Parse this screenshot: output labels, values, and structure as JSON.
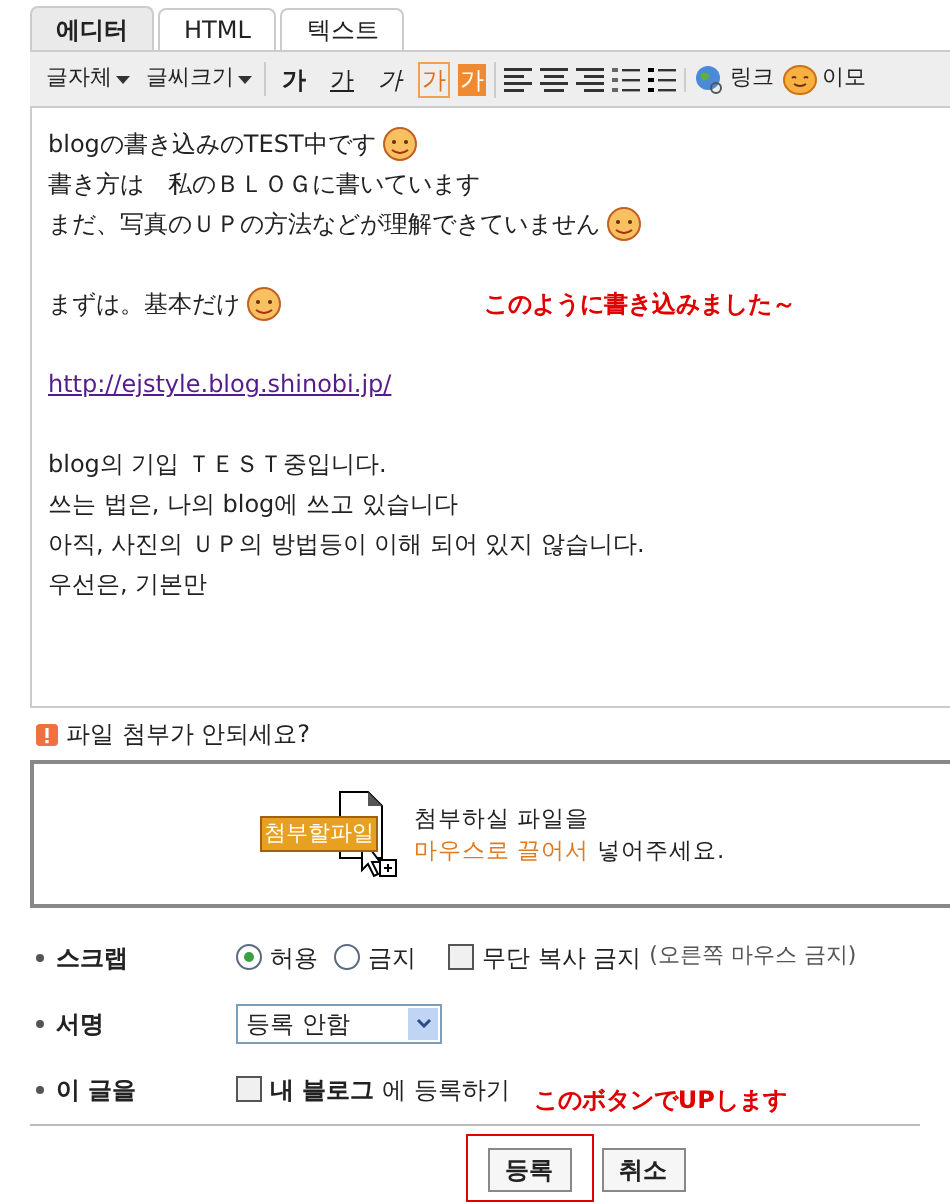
{
  "tabs": [
    {
      "label": "에디터",
      "selected": true
    },
    {
      "label": "HTML",
      "selected": false
    },
    {
      "label": "텍스트",
      "selected": false
    }
  ],
  "toolbar": {
    "groups": [
      [
        {
          "kind": "dropdown",
          "label": "글자체"
        },
        {
          "kind": "dropdown",
          "label": "글씨크기"
        }
      ],
      [
        {
          "kind": "bold",
          "label": "가"
        },
        {
          "kind": "underline",
          "label": "가"
        },
        {
          "kind": "italic",
          "label": "가"
        },
        {
          "kind": "color",
          "label": "가"
        },
        {
          "kind": "highlight",
          "label": "가"
        }
      ],
      [
        {
          "kind": "align-left"
        },
        {
          "kind": "align-center"
        },
        {
          "kind": "align-right"
        },
        {
          "kind": "numbered-list"
        },
        {
          "kind": "bullet-list"
        }
      ],
      [
        {
          "kind": "link",
          "label": "링크"
        },
        {
          "kind": "emoticon",
          "label": "이모"
        }
      ]
    ]
  },
  "content": {
    "lines": [
      {
        "kind": "text",
        "text": "blogの書き込みのTEST中です",
        "emoticon": true
      },
      {
        "kind": "text",
        "text": "書き方は　私のＢＬＯＧに書いています",
        "emoticon": false
      },
      {
        "kind": "text",
        "text": "まだ、写真のＵＰの方法などが理解できていません",
        "emoticon": true
      },
      {
        "kind": "blank"
      },
      {
        "kind": "text",
        "text": "まずは。基本だけ",
        "emoticon": true,
        "note": "このように書き込みました～"
      },
      {
        "kind": "blank"
      },
      {
        "kind": "link",
        "text": "http://ejstyle.blog.shinobi.jp/"
      },
      {
        "kind": "blank"
      },
      {
        "kind": "text",
        "text": "blog의 기입 ＴＥＳＴ중입니다.",
        "emoticon": false
      },
      {
        "kind": "text",
        "text": "쓰는 법은, 나의 blog에 쓰고 있습니다",
        "emoticon": false
      },
      {
        "kind": "text",
        "text": "아직, 사진의 ＵＰ의 방법등이 이해 되어 있지 않습니다.",
        "emoticon": false
      },
      {
        "kind": "text",
        "text": "우선은, 기본만",
        "emoticon": false
      }
    ]
  },
  "attach": {
    "help": "파일 첨부가 안되세요?",
    "file_label": "첨부할파일",
    "line1": "첨부하실 파일을",
    "emphasis": "마우스로 끌어서",
    "rest": "넣어주세요."
  },
  "form": {
    "scrap": {
      "label": "스크랩",
      "options": [
        {
          "label": "허용",
          "selected": true
        },
        {
          "label": "금지",
          "selected": false
        }
      ],
      "checkbox": {
        "label": "무단 복사 금지",
        "hint": "(오른쪽 마우스 금지)",
        "checked": false
      }
    },
    "signature": {
      "label": "서명",
      "value": "등록 안함"
    },
    "post": {
      "label": "이 글을",
      "checkbox": {
        "bold": "내 블로그",
        "rest": "에 등록하기",
        "checked": false
      },
      "note": "このボタンでUPします"
    }
  },
  "buttons": [
    {
      "label": "등록",
      "highlighted": true
    },
    {
      "label": "취소",
      "highlighted": false
    }
  ]
}
